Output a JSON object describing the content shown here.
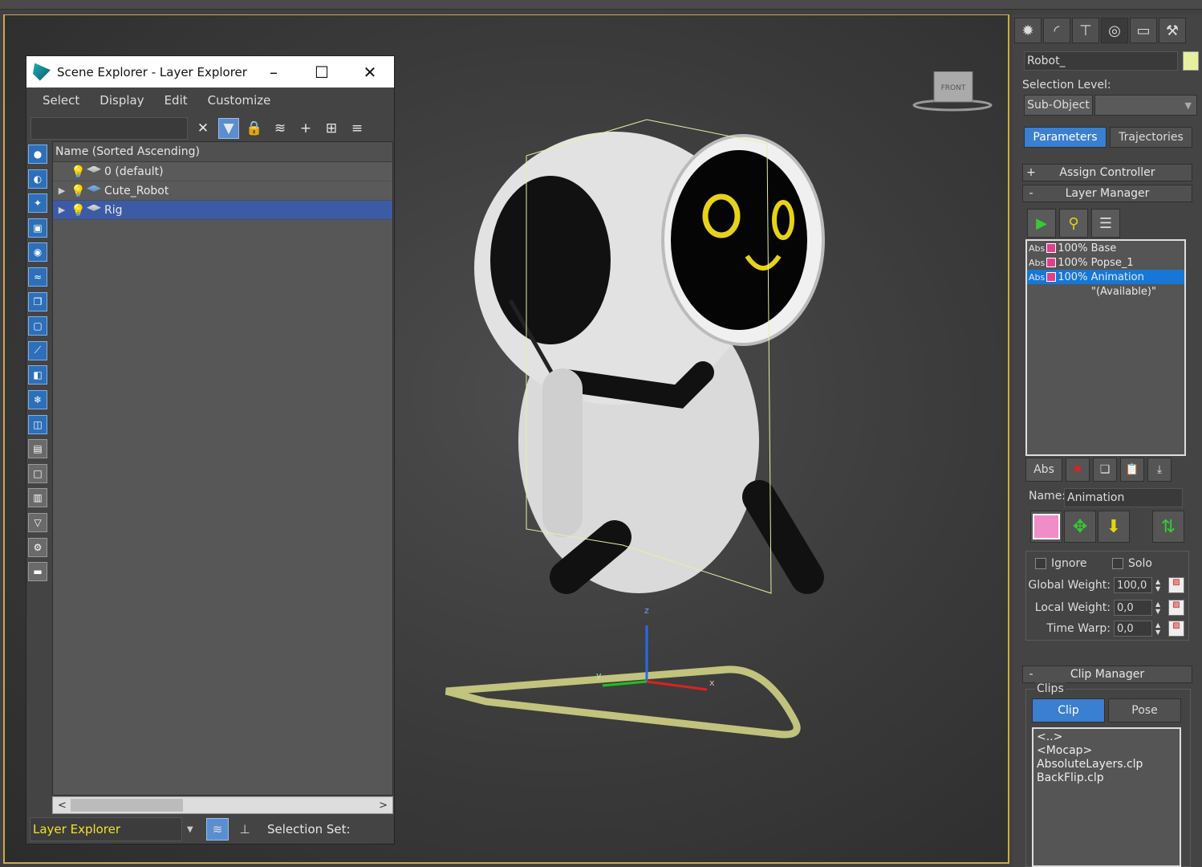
{
  "scene_explorer": {
    "title": "Scene Explorer - Layer Explorer",
    "menu": [
      "Select",
      "Display",
      "Edit",
      "Customize"
    ],
    "column_header": "Name (Sorted Ascending)",
    "rows": [
      {
        "label": "0 (default)",
        "expandable": false,
        "selected": false
      },
      {
        "label": "Cute_Robot",
        "expandable": true,
        "selected": false
      },
      {
        "label": "Rig",
        "expandable": true,
        "selected": true
      }
    ],
    "explorer_dropdown": "Layer Explorer",
    "selection_set_label": "Selection Set:"
  },
  "viewport": {
    "viewcube_label": "FRONT",
    "axes": {
      "x": "x",
      "y": "y",
      "z": "z"
    }
  },
  "command_panel": {
    "object_name": "Robot_",
    "object_color": "#e8f0a0",
    "selection_level_label": "Selection Level:",
    "sub_object_button": "Sub-Object",
    "tabs": [
      "Parameters",
      "Trajectories"
    ],
    "active_tab": "Parameters",
    "assign_controller": "Assign Controller",
    "layer_manager": {
      "title": "Layer Manager",
      "layers": [
        {
          "abs": "Abs",
          "pct": "100%",
          "name": "Base",
          "selected": false
        },
        {
          "abs": "Abs",
          "pct": "100%",
          "name": "Popse_1",
          "selected": false
        },
        {
          "abs": "Abs",
          "pct": "100%",
          "name": "Animation",
          "selected": true
        }
      ],
      "available": "\"(Available)\"",
      "new_button": "Abs",
      "name_label": "Name:",
      "name_value": "Animation",
      "ignore_label": "Ignore",
      "solo_label": "Solo",
      "global_weight_label": "Global Weight:",
      "global_weight": "100,0",
      "local_weight_label": "Local Weight:",
      "local_weight": "0,0",
      "time_warp_label": "Time Warp:",
      "time_warp": "0,0"
    },
    "clip_manager": {
      "title": "Clip Manager",
      "group_label": "Clips",
      "tabs": [
        "Clip",
        "Pose"
      ],
      "active_tab": "Clip",
      "items": [
        "<..>",
        "<Mocap>",
        "AbsoluteLayers.clp",
        "BackFlip.clp"
      ]
    }
  },
  "colors": {
    "accent": "#3a7fd0",
    "highlight": "#3c5aa6",
    "robot_face": "#e6d21a",
    "selection_yellow": "#e8f0a0"
  }
}
